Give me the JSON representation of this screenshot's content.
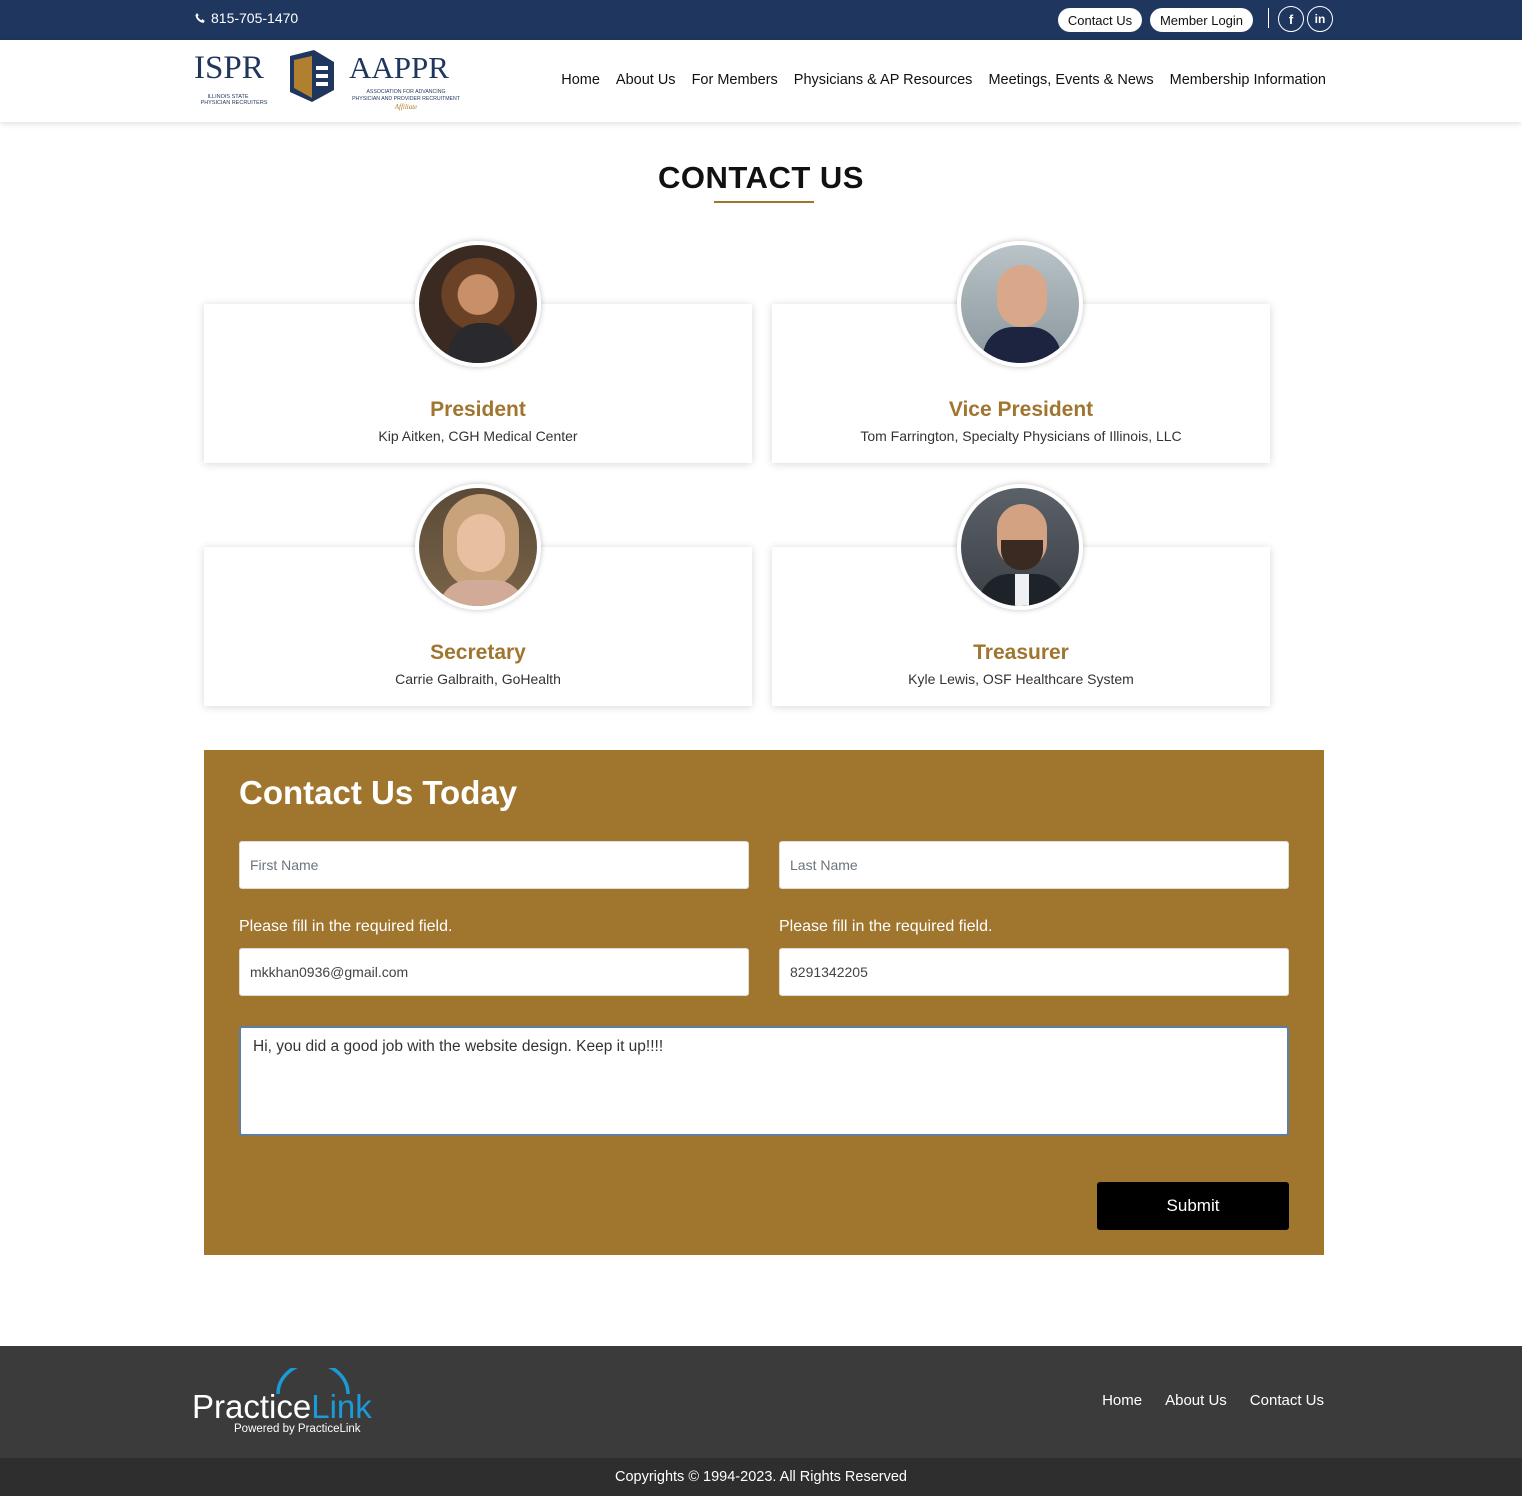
{
  "topbar": {
    "phone": "815-705-1470",
    "contact_label": "Contact Us",
    "login_label": "Member Login",
    "social": [
      "facebook-icon",
      "linkedin-icon"
    ]
  },
  "header": {
    "logo_left_text": "ISPR",
    "logo_left_sub1": "ILLINOIS STATE",
    "logo_left_sub2": "PHYSICIAN RECRUITERS",
    "logo_right_text": "AAPPR",
    "logo_right_sub1": "ASSOCIATION FOR ADVANCING",
    "logo_right_sub2": "PHYSICIAN AND PROVIDER RECRUITMENT",
    "logo_right_sub3": "Affiliate",
    "nav": [
      "Home",
      "About Us",
      "For Members",
      "Physicians & AP Resources",
      "Meetings, Events & News",
      "Membership Information"
    ]
  },
  "page_title": "CONTACT US",
  "officers": [
    {
      "role": "President",
      "person": "Kip Aitken, CGH Medical Center"
    },
    {
      "role": "Vice President",
      "person": "Tom Farrington, Specialty Physicians of Illinois, LLC"
    },
    {
      "role": "Secretary",
      "person": "Carrie Galbraith, GoHealth"
    },
    {
      "role": "Treasurer",
      "person": "Kyle Lewis, OSF Healthcare System"
    }
  ],
  "form": {
    "title": "Contact Us Today",
    "first_name_placeholder": "First Name",
    "last_name_placeholder": "Last Name",
    "required_msg_1": "Please fill in the required field.",
    "required_msg_2": "Please fill in the required field.",
    "email_value": "mkkhan0936@gmail.com",
    "phone_value": "8291342205",
    "message_value": "Hi, you did a good job with the website design. Keep it up!!!!",
    "submit_label": "Submit"
  },
  "footer": {
    "brand_main": "Practice",
    "brand_accent": "Link",
    "brand_sub": "Powered by PracticeLink",
    "nav": [
      "Home",
      "About Us",
      "Contact Us"
    ],
    "copyright": "Copyrights © 1994-2023. All Rights Reserved"
  },
  "colors": {
    "navy": "#1f365f",
    "gold": "#a0762e",
    "footer": "#3b3b3b",
    "link_blue": "#1a9ad6"
  }
}
